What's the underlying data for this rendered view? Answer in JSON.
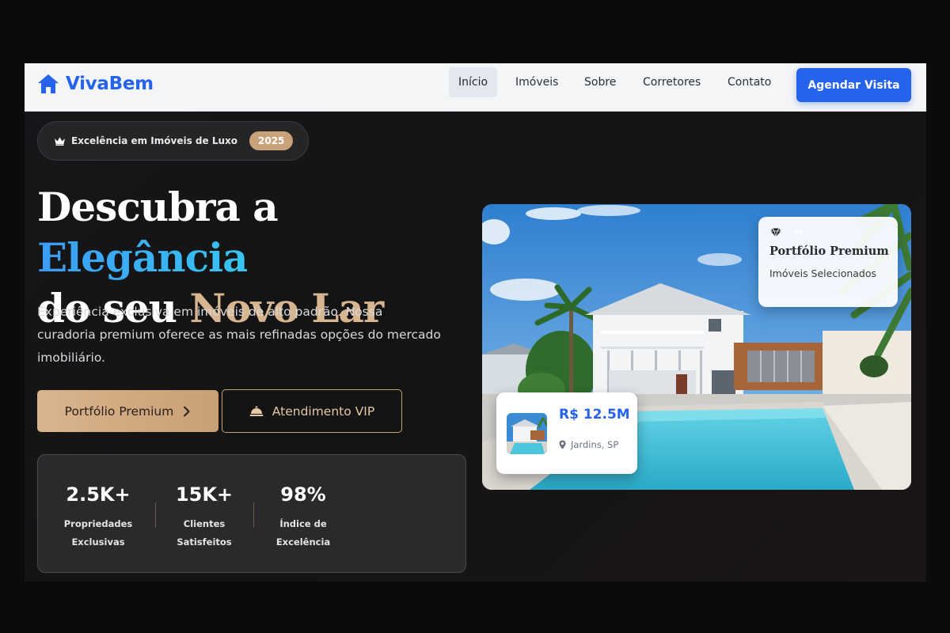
{
  "brand": {
    "name": "VivaBem",
    "logo_icon": "home-icon",
    "color": "#2563eb"
  },
  "nav": {
    "links": [
      {
        "label": "Início",
        "active": true
      },
      {
        "label": "Imóveis",
        "active": false
      },
      {
        "label": "Sobre",
        "active": false
      },
      {
        "label": "Corretores",
        "active": false
      },
      {
        "label": "Contato",
        "active": false
      }
    ],
    "cta_label": "Agendar Visita"
  },
  "badge": {
    "icon": "crown-icon",
    "text": "Excelência em Imóveis de Luxo",
    "year": "2025"
  },
  "hero": {
    "headline_part1": "Descubra a ",
    "headline_highlight1": "Elegância",
    "headline_part2": "do seu ",
    "headline_highlight2": "Novo Lar",
    "subtext": "Experiência exclusiva em imóveis de alto padrão. Nossa curadoria premium oferece as mais refinadas opções do mercado imobiliário.",
    "primary_button": {
      "label": "Portfólio Premium",
      "icon": "chevron-right-icon"
    },
    "secondary_button": {
      "label": "Atendimento VIP",
      "icon": "concierge-bell-icon"
    }
  },
  "stats": [
    {
      "value": "2.5K+",
      "label_line1": "Propriedades",
      "label_line2": "Exclusivas"
    },
    {
      "value": "15K+",
      "label_line1": "Clientes",
      "label_line2": "Satisfeitos"
    },
    {
      "value": "98%",
      "label_line1": "Índice de",
      "label_line2": "Excelência"
    }
  ],
  "premium_card": {
    "icon": "gem-icon",
    "title": "Portfólio Premium",
    "subtitle": "Imóveis Selecionados"
  },
  "price_card": {
    "price": "R$ 12.5M",
    "location": "Jardins, SP",
    "location_icon": "map-pin-icon"
  },
  "colors": {
    "accent_gold": "#c9a27a",
    "accent_blue": "#2563eb",
    "headline_blue": "#3b9cf5",
    "dark_bg": "#141414"
  }
}
